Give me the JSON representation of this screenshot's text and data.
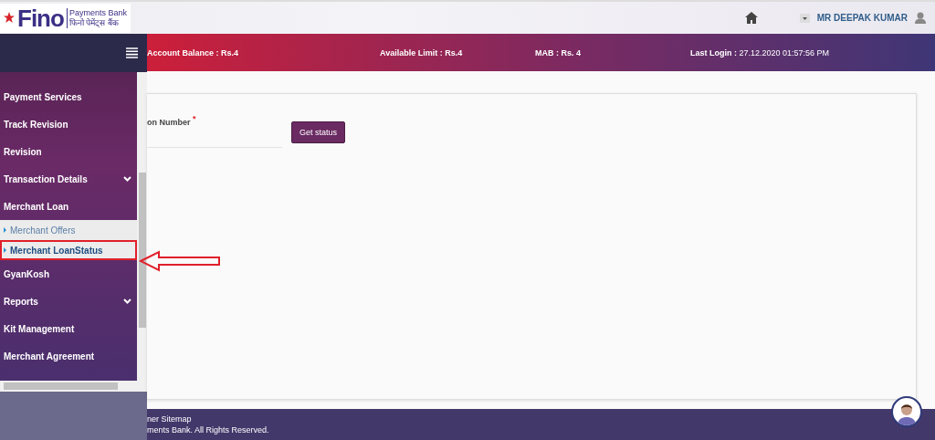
{
  "header": {
    "logo": {
      "brand": "Fino",
      "line1": "Payments Bank",
      "line2": "फिनो पेमेंट्स बैंक"
    },
    "user": "MR DEEPAK KUMAR"
  },
  "info_bar": [
    {
      "label": "Account Balance :",
      "value": "Rs.4",
      "value_bold": true
    },
    {
      "label": "Available Limit :",
      "value": "Rs.4",
      "value_bold": true
    },
    {
      "label": "MAB :",
      "value": "Rs. 4",
      "value_bold": true
    },
    {
      "label": "Last Login :",
      "value": "27.12.2020 01:57:56 PM",
      "value_bold": false
    }
  ],
  "sidebar": {
    "items": [
      {
        "label": "Payment Services",
        "submenu": false
      },
      {
        "label": "Track Revision",
        "submenu": false
      },
      {
        "label": "Revision",
        "submenu": false
      },
      {
        "label": "Transaction Details",
        "submenu": true
      },
      {
        "label": "Merchant Loan",
        "submenu": false,
        "expanded": true,
        "children": [
          {
            "label": "Merchant Offers",
            "selected": false
          },
          {
            "label": "Merchant LoanStatus",
            "selected": true
          }
        ]
      },
      {
        "label": "GyanKosh",
        "submenu": false
      },
      {
        "label": "Reports",
        "submenu": true
      },
      {
        "label": "Kit Management",
        "submenu": false
      },
      {
        "label": "Merchant Agreement",
        "submenu": false
      }
    ]
  },
  "form": {
    "field_label": "on Number",
    "required_mark": "*",
    "button": "Get status"
  },
  "footer": {
    "line1": "ner Sitemap",
    "line2": "ments Bank. All Rights Reserved."
  }
}
